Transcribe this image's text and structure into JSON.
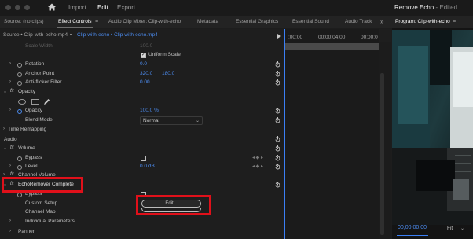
{
  "menu": {
    "items": [
      {
        "label": "Import",
        "active": false
      },
      {
        "label": "Edit",
        "active": true
      },
      {
        "label": "Export",
        "active": false
      }
    ]
  },
  "window": {
    "project": "Remove Echo",
    "status": "- Edited"
  },
  "tabs": [
    {
      "label": "Source: (no clips)",
      "active": false
    },
    {
      "label": "Effect Controls",
      "active": true
    },
    {
      "label": "Audio Clip Mixer: Clip-with-echo",
      "active": false
    },
    {
      "label": "Metadata",
      "active": false
    },
    {
      "label": "Essential Graphics",
      "active": false
    },
    {
      "label": "Essential Sound",
      "active": false
    },
    {
      "label": "Audio Track",
      "active": false
    }
  ],
  "program": {
    "title": "Program: Clip-with-echo",
    "timecode": "00;00;00;00",
    "zoom": "Fit"
  },
  "effect_controls": {
    "source_label": "Source • Clip-with-echo.mp4",
    "sequence_label": "Clip-with-echo • Clip-with-echo.mp4",
    "ruler_start": ":00;00",
    "ruler_mid": "00;00;04;00",
    "ruler_end": "00;00;0",
    "scale_width": {
      "label": "Scale Width",
      "value": "100.0"
    },
    "uniform_scale": "Uniform Scale",
    "rotation": {
      "label": "Rotation",
      "value": "0.0"
    },
    "anchor_point": {
      "label": "Anchor Point",
      "x": "320.0",
      "y": "180.0"
    },
    "anti_flicker": {
      "label": "Anti-flicker Filter",
      "value": "0.00"
    },
    "opacity_section": "Opacity",
    "opacity": {
      "label": "Opacity",
      "value": "100.0 %"
    },
    "blend_mode": {
      "label": "Blend Mode",
      "value": "Normal"
    },
    "time_remapping": "Time Remapping",
    "audio_header": "Audio",
    "volume_section": "Volume",
    "bypass": "Bypass",
    "level": {
      "label": "Level",
      "value": "0.0 dB"
    },
    "channel_volume": "Channel Volume",
    "echo_remover": "EchoRemover Complete",
    "bypass2": "Bypass",
    "custom_setup": {
      "label": "Custom Setup",
      "button": "Edit..."
    },
    "channel_map": "Channel Map",
    "individual_parameters": "Individual Parameters",
    "panner": "Panner",
    "fx": "fx"
  },
  "colors": {
    "accent": "#4c8cf0",
    "highlight": "#e0101a",
    "playhead": "#3b7ff5"
  }
}
